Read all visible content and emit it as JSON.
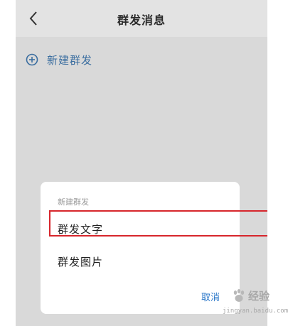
{
  "header": {
    "title": "群发消息",
    "back_icon": "chevron-left-icon"
  },
  "main": {
    "new_broadcast_label": "新建群发",
    "new_broadcast_icon": "plus-circle-icon"
  },
  "dialog": {
    "title": "新建群发",
    "options": [
      {
        "label": "群发文字",
        "highlighted": true
      },
      {
        "label": "群发图片",
        "highlighted": false
      }
    ],
    "cancel_label": "取消"
  },
  "watermark": {
    "brand": "经验",
    "url": "jingyan.baidu.com"
  },
  "colors": {
    "accent": "#2a77c9",
    "highlight": "#d7262c",
    "overlay": "#d9d9d9"
  }
}
